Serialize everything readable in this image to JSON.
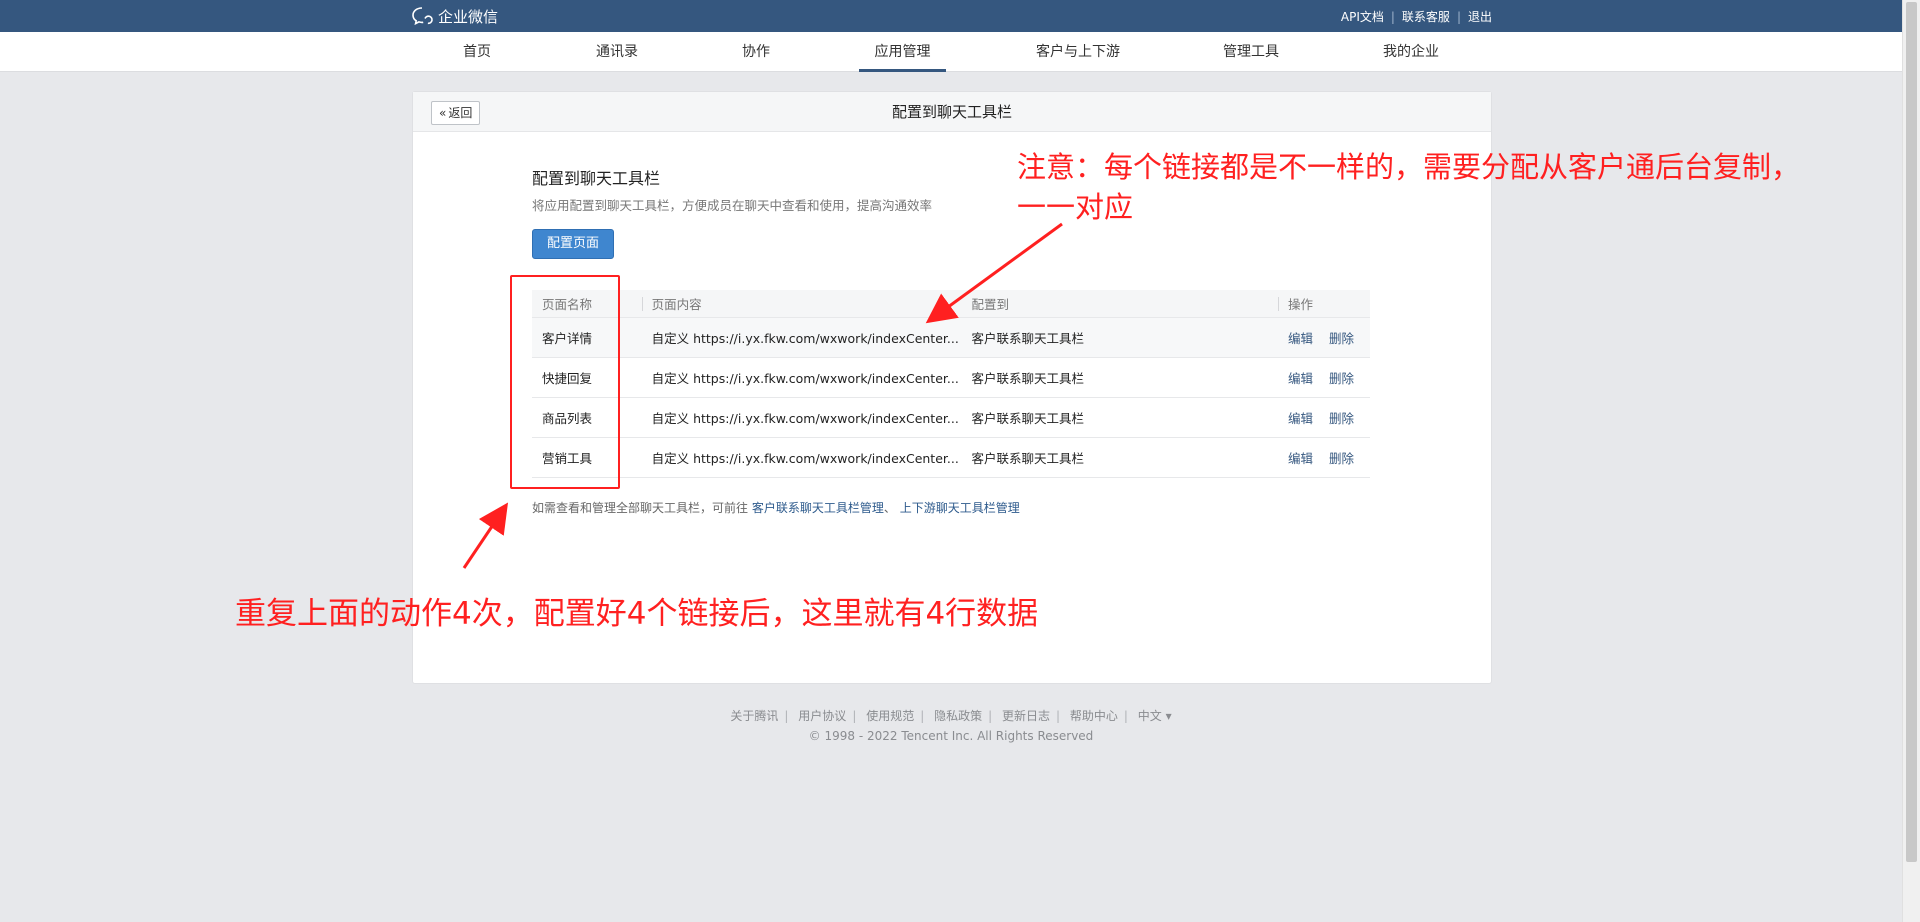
{
  "topbar": {
    "brand": "企业微信",
    "links": [
      "API文档",
      "联系客服",
      "退出"
    ]
  },
  "nav": {
    "items": [
      "首页",
      "通讯录",
      "协作",
      "应用管理",
      "客户与上下游",
      "管理工具",
      "我的企业"
    ],
    "active": "应用管理"
  },
  "panel": {
    "back_label": "返回",
    "title": "配置到聊天工具栏",
    "section_title": "配置到聊天工具栏",
    "section_desc": "将应用配置到聊天工具栏，方便成员在聊天中查看和使用，提高沟通效率",
    "config_button": "配置页面"
  },
  "table": {
    "headers": [
      "页面名称",
      "页面内容",
      "配置到",
      "操作"
    ],
    "rows": [
      {
        "name": "客户详情",
        "content": "自定义 https://i.yx.fkw.com/wxwork/indexCenter...",
        "target": "客户联系聊天工具栏",
        "edit": "编辑",
        "delete": "删除"
      },
      {
        "name": "快捷回复",
        "content": "自定义 https://i.yx.fkw.com/wxwork/indexCenter...",
        "target": "客户联系聊天工具栏",
        "edit": "编辑",
        "delete": "删除"
      },
      {
        "name": "商品列表",
        "content": "自定义 https://i.yx.fkw.com/wxwork/indexCenter...",
        "target": "客户联系聊天工具栏",
        "edit": "编辑",
        "delete": "删除"
      },
      {
        "name": "营销工具",
        "content": "自定义 https://i.yx.fkw.com/wxwork/indexCenter...",
        "target": "客户联系聊天工具栏",
        "edit": "编辑",
        "delete": "删除"
      }
    ]
  },
  "bottom_note": {
    "prefix": "如需查看和管理全部聊天工具栏，可前往",
    "link1": "客户联系聊天工具栏管理",
    "joiner": "、",
    "link2": "上下游聊天工具栏管理"
  },
  "footer": {
    "links": [
      "关于腾讯",
      "用户协议",
      "使用规范",
      "隐私政策",
      "更新日志",
      "帮助中心",
      "中文 ▾"
    ],
    "copyright": "© 1998 - 2022 Tencent Inc. All Rights Reserved"
  },
  "annotations": {
    "top_line1": "注意：每个链接都是不一样的，需要分配从客户通后台复制，",
    "top_line2": "一一对应",
    "bottom": "重复上面的动作4次，配置好4个链接后，这里就有4行数据",
    "color": "#ff2020"
  },
  "colors": {
    "topbar": "#35577f",
    "primary": "#3f86cf",
    "link": "#35577f"
  }
}
